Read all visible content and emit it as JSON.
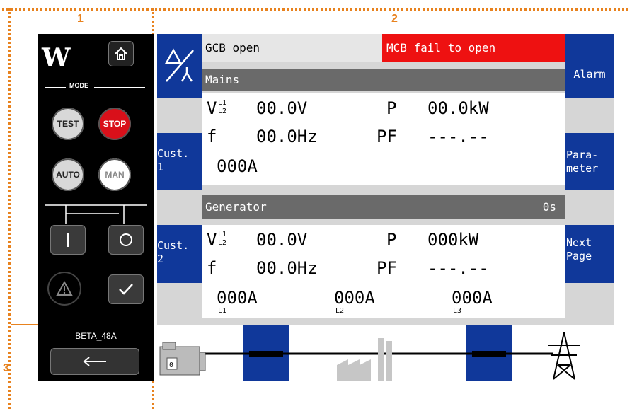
{
  "annotations": {
    "one": "1",
    "two": "2",
    "three": "3"
  },
  "panel": {
    "mode_label": "MODE",
    "buttons": {
      "test": "TEST",
      "stop": "STOP",
      "auto": "AUTO",
      "man": "MAN"
    },
    "device_name": "BETA_48A",
    "logo_text": "W"
  },
  "screen": {
    "status": {
      "gcb": "GCB open",
      "mcb": "MCB fail to open"
    },
    "nav": {
      "alarm": "Alarm",
      "cust1": "Cust.\n1",
      "param": "Para-\nmeter",
      "cust2": "Cust.\n2",
      "next": "Next\nPage"
    },
    "mains": {
      "header": "Mains",
      "v_label": "V",
      "v_sub_top": "L1",
      "v_sub_bot": "L2",
      "voltage": "00.0V",
      "p_label": "P",
      "power": "00.0kW",
      "f_label": "f",
      "freq": "00.0Hz",
      "pf_label": "PF",
      "pf": "---.--",
      "current": "000A"
    },
    "generator": {
      "header": "Generator",
      "timer": "0s",
      "v_label": "V",
      "v_sub_top": "L1",
      "v_sub_bot": "L2",
      "voltage": "00.0V",
      "p_label": "P",
      "power": "000kW",
      "f_label": "f",
      "freq": "00.0Hz",
      "pf_label": "PF",
      "pf": "---.--",
      "currents": [
        {
          "value": "000A",
          "phase": "L1"
        },
        {
          "value": "000A",
          "phase": "L2"
        },
        {
          "value": "000A",
          "phase": "L3"
        }
      ]
    },
    "diagram": {
      "genset_digit": "0"
    }
  },
  "colors": {
    "accent_blue": "#10389a",
    "alarm_red": "#ee1111",
    "annotation_orange": "#e8821e"
  }
}
